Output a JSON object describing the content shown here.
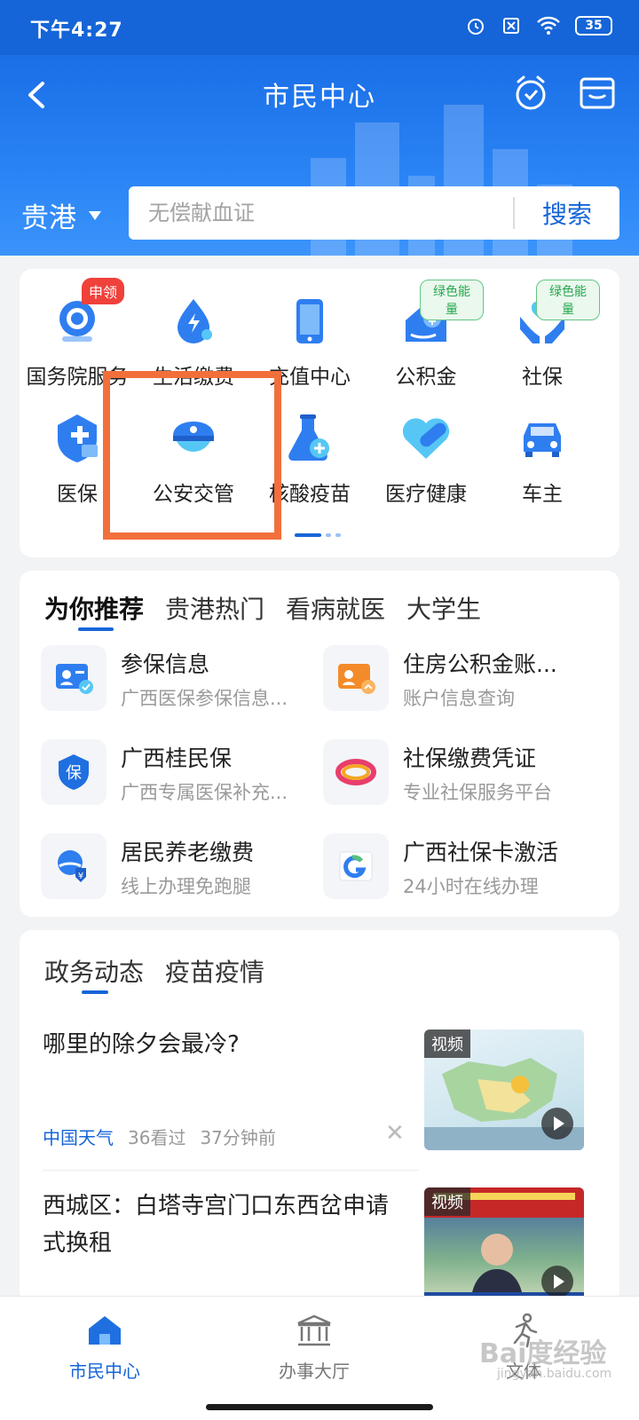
{
  "status_bar": {
    "time": "下午4:27",
    "battery": "35"
  },
  "header": {
    "title": "市民中心",
    "city": "贵港"
  },
  "search": {
    "placeholder": "无偿献血证",
    "button": "搜索"
  },
  "services": [
    {
      "label": "国务院服务",
      "icon": "state-council-icon",
      "badge": "申领"
    },
    {
      "label": "生活缴费",
      "icon": "utility-bill-icon"
    },
    {
      "label": "充值中心",
      "icon": "phone-recharge-icon"
    },
    {
      "label": "公积金",
      "icon": "housing-fund-icon",
      "badge": "绿色能量"
    },
    {
      "label": "社保",
      "icon": "social-security-icon",
      "badge": "绿色能量"
    },
    {
      "label": "医保",
      "icon": "medical-insurance-icon"
    },
    {
      "label": "公安交管",
      "icon": "police-cap-icon"
    },
    {
      "label": "核酸疫苗",
      "icon": "flask-icon"
    },
    {
      "label": "医疗健康",
      "icon": "pill-heart-icon"
    },
    {
      "label": "车主",
      "icon": "car-icon"
    }
  ],
  "recommend": {
    "tabs": [
      "为你推荐",
      "贵港热门",
      "看病就医",
      "大学生"
    ],
    "items": [
      {
        "title": "参保信息",
        "subtitle": "广西医保参保信息...",
        "icon": "insurance-card-icon"
      },
      {
        "title": "住房公积金账...",
        "subtitle": "账户信息查询",
        "icon": "fund-account-icon"
      },
      {
        "title": "广西桂民保",
        "subtitle": "广西专属医保补充...",
        "icon": "shield-bao-icon"
      },
      {
        "title": "社保缴费凭证",
        "subtitle": "专业社保服务平台",
        "icon": "swirl-logo-icon"
      },
      {
        "title": "居民养老缴费",
        "subtitle": "线上办理免跑腿",
        "icon": "pension-icon"
      },
      {
        "title": "广西社保卡激活",
        "subtitle": "24小时在线办理",
        "icon": "social-card-icon"
      }
    ]
  },
  "news": {
    "tabs": [
      "政务动态",
      "疫苗疫情"
    ],
    "items": [
      {
        "title": "哪里的除夕会最冷?",
        "source": "中国天气",
        "views": "36看过",
        "time": "37分钟前",
        "tag": "视频"
      },
      {
        "title": "西城区：白塔寺宫门口东西岔申请式换租",
        "tag": "视频"
      }
    ]
  },
  "bottom_nav": [
    {
      "label": "市民中心",
      "icon": "home-icon",
      "active": true
    },
    {
      "label": "办事大厅",
      "icon": "hall-icon"
    },
    {
      "label": "文体",
      "icon": "runner-icon"
    }
  ],
  "watermark": {
    "text": "Bai度经验",
    "sub": "jingyan.baidu.com"
  },
  "colors": {
    "primary": "#1565d8",
    "highlight": "#f26f3c",
    "badge_red": "#f0413b",
    "badge_green": "#27a64c"
  }
}
